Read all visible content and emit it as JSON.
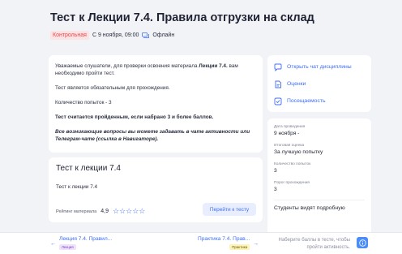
{
  "page": {
    "title": "Тест к Лекции 7.4. Правила отгрузки на склад",
    "badge": "Контрольная",
    "datetime": "С 9 ноября, 09:00",
    "format": "Офлайн"
  },
  "instructions": {
    "intro_before": "Уважаемые слушатели, для проверки освоения материала ",
    "intro_bold": "Лекции 7.4.",
    "intro_after": " вам необходимо пройти тест.",
    "mandatory": "Тест является обязательным для прохождения.",
    "attempts": "Количество попыток - 3",
    "pass_condition": "Тест считается пройденным, если набрано 3 и более баллов.",
    "questions": "Все возникающие вопросы вы можете задавать в чате активности или Телеграм-чате (ссылка в Навигаторе)."
  },
  "test_card": {
    "title": "Тест к лекции 7.4",
    "subtitle": "Тест к лекции 7.4",
    "rating_label": "Рейтинг материала",
    "rating_value": "4,9",
    "stars": "☆☆☆☆☆",
    "button": "Перейти к тесту"
  },
  "links": {
    "chat": "Открыть чат дисциплины",
    "grades": "Оценки",
    "attendance": "Посещаемость"
  },
  "info": {
    "date_label": "Дата проведения",
    "date_value": "9 ноября -",
    "grade_label": "Итоговая оценка",
    "grade_value": "За лучшую попытку",
    "attempts_label": "Количество попыток",
    "attempts_value": "3",
    "threshold_label": "Порог прохождения",
    "threshold_value": "3",
    "students_see": "Студенты видят подробную"
  },
  "footer": {
    "prev_title": "Лекция 7.4. Правил...",
    "prev_tag": "Лекция",
    "next_title": "Практика 7.4. Прав...",
    "next_tag": "Практика",
    "hint": "Наберите баллы в тесте, чтобы пройти активность."
  },
  "colors": {
    "accent": "#3f6df4",
    "danger": "#e5484d",
    "background": "#f2f3f7"
  }
}
